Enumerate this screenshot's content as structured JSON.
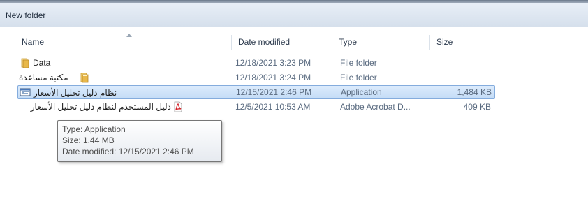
{
  "window": {
    "title": "New folder"
  },
  "columns": [
    {
      "label": "Name"
    },
    {
      "label": "Date modified"
    },
    {
      "label": "Type"
    },
    {
      "label": "Size"
    }
  ],
  "files": [
    {
      "name": "Data",
      "date": "12/18/2021 3:23 PM",
      "type": "File folder",
      "size": "",
      "icon": "folder-icon"
    },
    {
      "name": "مكتبة مساعدة",
      "date": "12/18/2021 3:24 PM",
      "type": "File folder",
      "size": "",
      "icon": "folder-icon"
    },
    {
      "name": "نظام دليل تحليل الأسعار",
      "date": "12/15/2021 2:46 PM",
      "type": "Application",
      "size": "1,484 KB",
      "icon": "application-icon",
      "selected": true
    },
    {
      "name": "دليل المستخدم لنظام دليل تحليل الأسعار",
      "date": "12/5/2021 10:53 AM",
      "type": "Adobe Acrobat D...",
      "size": "409 KB",
      "icon": "pdf-icon"
    }
  ],
  "tooltip": {
    "type_line": "Type: Application",
    "size_line": "Size: 1.44 MB",
    "date_line": "Date modified: 12/15/2021 2:46 PM"
  },
  "colors": {
    "selection": "#cfe3f8",
    "selection_border": "#84acdd",
    "folder": "#e8b84a",
    "pdf": "#d4232a"
  }
}
